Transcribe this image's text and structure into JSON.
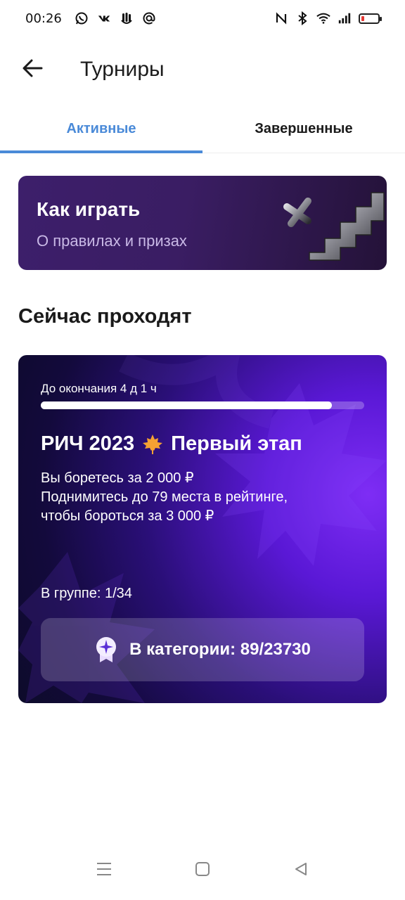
{
  "status_bar": {
    "time": "00:26",
    "left_icons": [
      "whatsapp-icon",
      "vk-icon",
      "clubhouse-icon",
      "at-sign-icon"
    ],
    "right_icons": [
      "nfc-icon",
      "bluetooth-icon",
      "wifi-icon",
      "signal-icon",
      "battery-icon"
    ],
    "battery_color": "#e53935"
  },
  "header": {
    "title": "Турниры",
    "back_icon": "arrow-left-icon"
  },
  "tabs": [
    {
      "label": "Активные",
      "active": true
    },
    {
      "label": "Завершенные",
      "active": false
    }
  ],
  "accent_color": "#4a8ad8",
  "how_to_play": {
    "title": "Как играть",
    "subtitle": "О правилах и призах"
  },
  "section": {
    "title": "Сейчас проходят"
  },
  "tournament": {
    "time_left": "До окончания 4 д 1 ч",
    "progress_fraction": 0.9,
    "title_part1": "РИЧ 2023",
    "title_part2": "Первый этап",
    "title_icon": "maple-leaf-icon",
    "line1": "Вы боретесь за 2 000 ₽",
    "line2": "Поднимитесь до 79 места в рейтинге,",
    "line3": "чтобы бороться за 3 000 ₽",
    "group": "В группе: 1/34",
    "category": "В категории: 89/23730",
    "category_icon": "medal-icon"
  },
  "nav_bar": {
    "icons": [
      "menu-icon",
      "home-square-icon",
      "back-triangle-icon"
    ]
  }
}
